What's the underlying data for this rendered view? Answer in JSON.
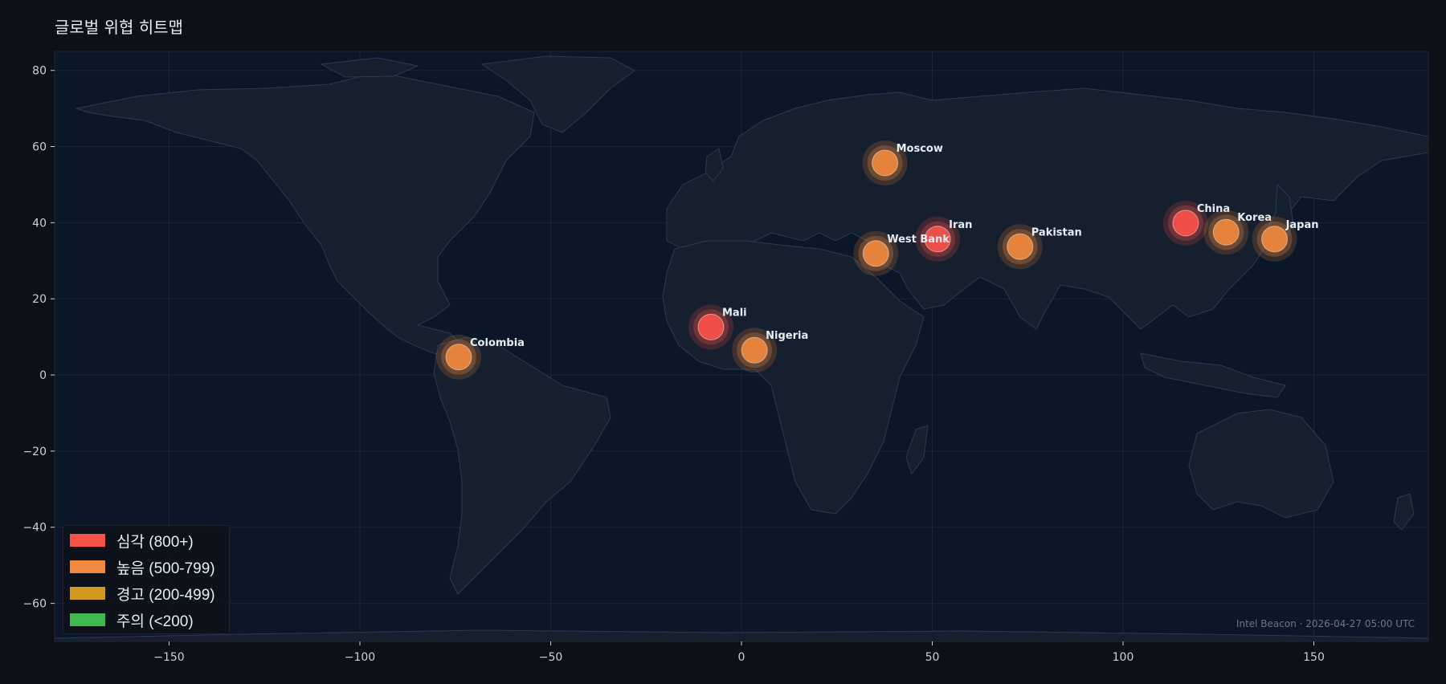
{
  "page": {
    "title": "글로벌 위협 히트맵",
    "footer": "Intel Beacon · 2026-04-27 05:00 UTC"
  },
  "colors": {
    "critical": "#f85149",
    "high": "#f0883e",
    "warning": "#d29922",
    "caution": "#3fb950",
    "ocean": "#0b1628",
    "land": "#161f2e",
    "border": "#2a3a55"
  },
  "legend": [
    {
      "label": "심각 (800+)",
      "color": "#f85149"
    },
    {
      "label": "높음 (500-799)",
      "color": "#f0883e"
    },
    {
      "label": "경고 (200-499)",
      "color": "#d29922"
    },
    {
      "label": "주의 (<200)",
      "color": "#3fb950"
    }
  ],
  "chart_data": {
    "type": "scatter",
    "title": "글로벌 위협 히트맵",
    "xlim": [
      -180,
      180
    ],
    "ylim": [
      -70,
      85
    ],
    "xticks": [
      -150,
      -100,
      -50,
      0,
      50,
      100,
      150
    ],
    "yticks": [
      -60,
      -40,
      -20,
      0,
      20,
      40,
      60,
      80
    ],
    "xtick_labels": [
      "−150",
      "−100",
      "−50",
      "0",
      "50",
      "100",
      "150"
    ],
    "ytick_labels": [
      "−60",
      "−40",
      "−20",
      "0",
      "20",
      "40",
      "60",
      "80"
    ],
    "grid": true,
    "legend_position": "bottom-left",
    "points": [
      {
        "name": "Moscow",
        "lon": 37.6,
        "lat": 55.7,
        "level": "high"
      },
      {
        "name": "Iran",
        "lon": 51.4,
        "lat": 35.7,
        "level": "critical"
      },
      {
        "name": "West Bank",
        "lon": 35.2,
        "lat": 31.9,
        "level": "high"
      },
      {
        "name": "Pakistan",
        "lon": 73.0,
        "lat": 33.7,
        "level": "high"
      },
      {
        "name": "China",
        "lon": 116.4,
        "lat": 39.9,
        "level": "critical"
      },
      {
        "name": "Korea",
        "lon": 127.0,
        "lat": 37.5,
        "level": "high"
      },
      {
        "name": "Japan",
        "lon": 139.7,
        "lat": 35.7,
        "level": "high"
      },
      {
        "name": "Mali",
        "lon": -8.0,
        "lat": 12.6,
        "level": "critical"
      },
      {
        "name": "Nigeria",
        "lon": 3.4,
        "lat": 6.5,
        "level": "high"
      },
      {
        "name": "Colombia",
        "lon": -74.1,
        "lat": 4.7,
        "level": "high"
      }
    ]
  }
}
